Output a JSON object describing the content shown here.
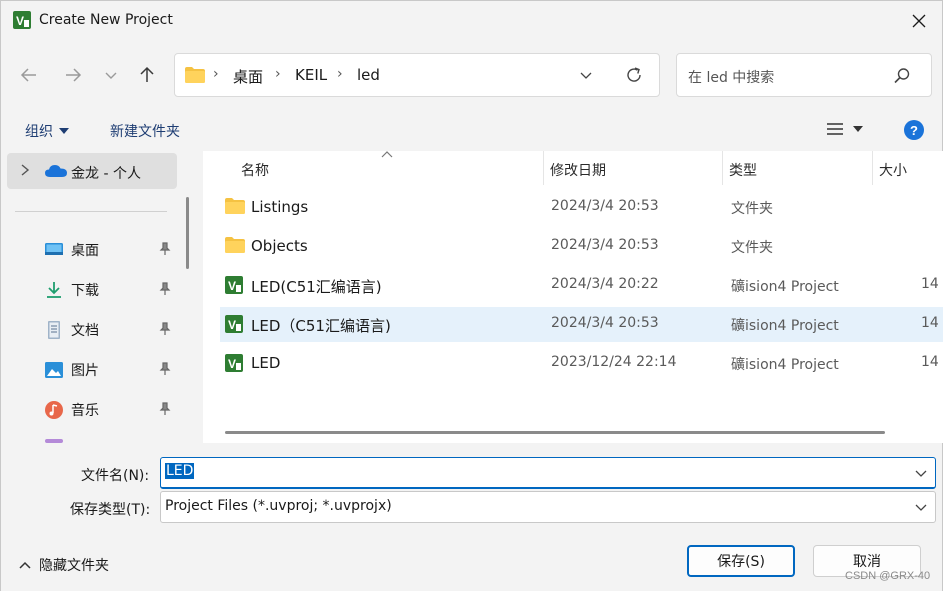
{
  "window": {
    "title": "Create New Project"
  },
  "address_bar": {
    "crumbs": [
      "桌面",
      "KEIL",
      "led"
    ]
  },
  "search": {
    "placeholder": "在 led 中搜索"
  },
  "toolbar": {
    "organize_label": "组织",
    "new_folder_label": "新建文件夹"
  },
  "nav_pane": {
    "onedrive_label": "金龙 - 个人",
    "items": [
      {
        "label": "桌面",
        "icon": "desktop-icon"
      },
      {
        "label": "下载",
        "icon": "download-icon"
      },
      {
        "label": "文档",
        "icon": "documents-icon"
      },
      {
        "label": "图片",
        "icon": "pictures-icon"
      },
      {
        "label": "音乐",
        "icon": "music-icon"
      }
    ]
  },
  "file_list": {
    "columns": {
      "name": "名称",
      "date": "修改日期",
      "type": "类型",
      "size": "大小"
    },
    "rows": [
      {
        "name": "Listings",
        "date": "2024/3/4 20:53",
        "type": "文件夹",
        "size": "",
        "icon": "folder-icon",
        "selected": false
      },
      {
        "name": "Objects",
        "date": "2024/3/4 20:53",
        "type": "文件夹",
        "size": "",
        "icon": "folder-icon",
        "selected": false
      },
      {
        "name": "LED(C51汇编语言)",
        "date": "2024/3/4 20:22",
        "type": "礦ision4 Project",
        "size": "14",
        "icon": "uvision-icon",
        "selected": false
      },
      {
        "name": "LED（C51汇编语言)",
        "date": "2024/3/4 20:53",
        "type": "礦ision4 Project",
        "size": "14",
        "icon": "uvision-icon",
        "selected": true
      },
      {
        "name": "LED",
        "date": "2023/12/24 22:14",
        "type": "礦ision4 Project",
        "size": "14",
        "icon": "uvision-icon",
        "selected": false
      }
    ]
  },
  "form": {
    "filename_label": "文件名(N):",
    "filename_value": "LED",
    "filetype_label": "保存类型(T):",
    "filetype_value": "Project Files (*.uvproj; *.uvprojx)",
    "hide_folders_label": "隐藏文件夹",
    "save_label": "保存(S)",
    "cancel_label": "取消"
  },
  "watermark": "CSDN @GRX-40",
  "colors": {
    "accent": "#0067c0",
    "selected_row": "#e5f1fb",
    "folder": "#f5c242",
    "uvision_green": "#2e7d32"
  }
}
